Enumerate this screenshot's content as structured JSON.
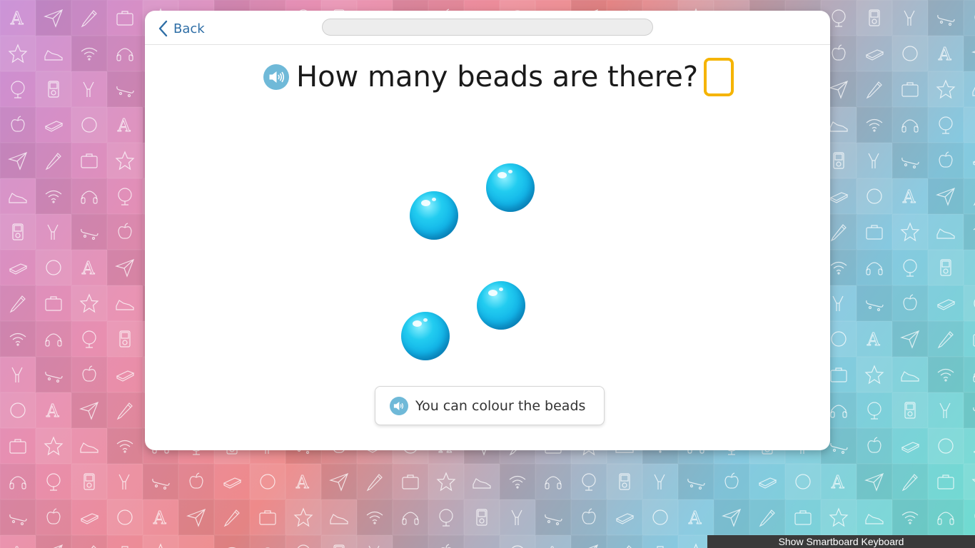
{
  "header": {
    "back_label": "Back",
    "progress_fraction": 0
  },
  "question": {
    "text": "How many beads are there?",
    "speaker_icon": "speaker-icon",
    "answer_value": "",
    "answer_border_color": "#f5b400"
  },
  "beads": {
    "count_shown": 4,
    "color": "#12b4e8"
  },
  "hint": {
    "label": "You can colour the beads",
    "speaker_icon": "speaker-icon"
  },
  "footer": {
    "keyboard_label": "Show Smartboard Keyboard"
  },
  "background": {
    "pattern_icons": [
      "letter-a-icon",
      "paper-plane-icon",
      "pencil-icon",
      "briefcase-icon",
      "star-icon",
      "sneaker-icon",
      "wifi-icon",
      "headphones-icon",
      "globe-icon",
      "ipod-icon",
      "slingshot-icon",
      "skateboard-icon",
      "apple-icon",
      "book-icon",
      "circle-icon"
    ]
  }
}
